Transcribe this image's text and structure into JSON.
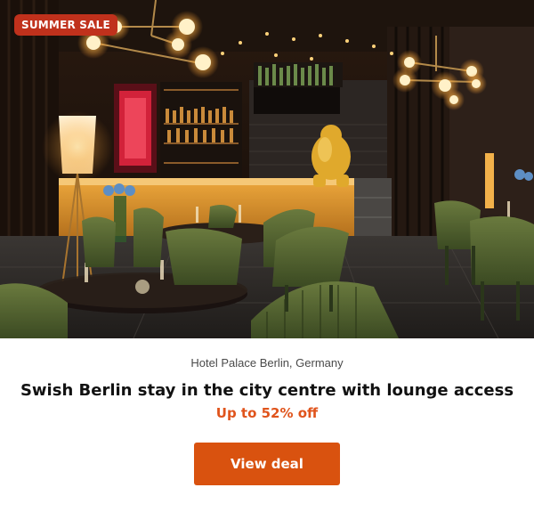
{
  "hero": {
    "badge": "SUMMER SALE",
    "image_alt": "Hotel restaurant and bar interior with green velvet chairs and warm lighting"
  },
  "deal": {
    "location": "Hotel Palace Berlin, Germany",
    "title": "Swish Berlin stay in the city centre with lounge access",
    "discount": "Up to 52% off",
    "cta_label": "View deal"
  },
  "colors": {
    "badge_bg": "#c0311c",
    "discount_text": "#e0541c",
    "cta_bg": "#d9520f"
  }
}
